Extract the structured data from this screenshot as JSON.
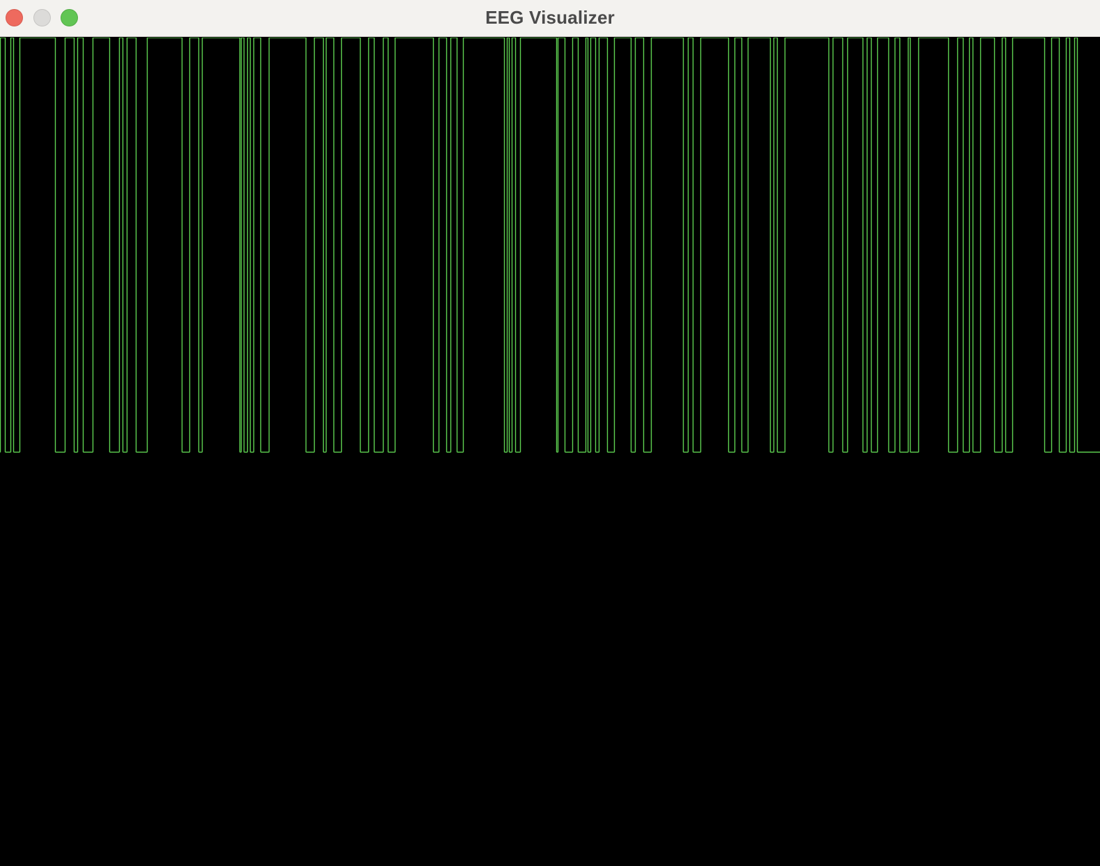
{
  "window": {
    "title": "EEG Visualizer",
    "controls": {
      "close": "close-icon",
      "minimize": "minimize-icon",
      "zoom": "zoom-icon"
    }
  },
  "colors": {
    "titlebar_bg": "#f3f2ef",
    "title_text": "#4a4a4a",
    "canvas_bg": "#000000",
    "trace": "#5fd352",
    "close": "#ee6a5e",
    "minimize": "#dcdbd9",
    "zoom": "#61c554"
  },
  "chart_data": {
    "type": "line",
    "title": "",
    "xlabel": "",
    "ylabel": "",
    "grid": false,
    "legend": "none",
    "ylim": [
      0,
      1
    ],
    "series": [
      {
        "name": "",
        "pulses": [
          [
            0.0,
            0.0045
          ],
          [
            0.0095,
            0.012
          ],
          [
            0.018,
            0.05
          ],
          [
            0.059,
            0.067
          ],
          [
            0.07,
            0.075
          ],
          [
            0.084,
            0.0995
          ],
          [
            0.1085,
            0.1115
          ],
          [
            0.1155,
            0.1235
          ],
          [
            0.1335,
            0.1655
          ],
          [
            0.172,
            0.1805
          ],
          [
            0.1835,
            0.2175
          ],
          [
            0.219,
            0.2215
          ],
          [
            0.2245,
            0.227
          ],
          [
            0.2305,
            0.2365
          ],
          [
            0.2445,
            0.278
          ],
          [
            0.2855,
            0.2935
          ],
          [
            0.296,
            0.303
          ],
          [
            0.31,
            0.3275
          ],
          [
            0.335,
            0.34
          ],
          [
            0.348,
            0.3525
          ],
          [
            0.359,
            0.3935
          ],
          [
            0.399,
            0.4055
          ],
          [
            0.4095,
            0.415
          ],
          [
            0.421,
            0.458
          ],
          [
            0.461,
            0.4625
          ],
          [
            0.465,
            0.4685
          ],
          [
            0.4725,
            0.506
          ],
          [
            0.507,
            0.5135
          ],
          [
            0.52,
            0.525
          ],
          [
            0.5325,
            0.534
          ],
          [
            0.537,
            0.541
          ],
          [
            0.544,
            0.552
          ],
          [
            0.558,
            0.5735
          ],
          [
            0.577,
            0.585
          ],
          [
            0.592,
            0.621
          ],
          [
            0.625,
            0.63
          ],
          [
            0.637,
            0.662
          ],
          [
            0.6675,
            0.674
          ],
          [
            0.6795,
            0.7
          ],
          [
            0.703,
            0.7065
          ],
          [
            0.713,
            0.753
          ],
          [
            0.757,
            0.766
          ],
          [
            0.77,
            0.784
          ],
          [
            0.788,
            0.792
          ],
          [
            0.7975,
            0.8075
          ],
          [
            0.8135,
            0.818
          ],
          [
            0.825,
            0.8275
          ],
          [
            0.8345,
            0.862
          ],
          [
            0.87,
            0.8755
          ],
          [
            0.881,
            0.884
          ],
          [
            0.891,
            0.904
          ],
          [
            0.911,
            0.914
          ],
          [
            0.92,
            0.9495
          ],
          [
            0.956,
            0.9625
          ],
          [
            0.969,
            0.972
          ],
          [
            0.9765,
            0.979
          ]
        ]
      }
    ]
  }
}
